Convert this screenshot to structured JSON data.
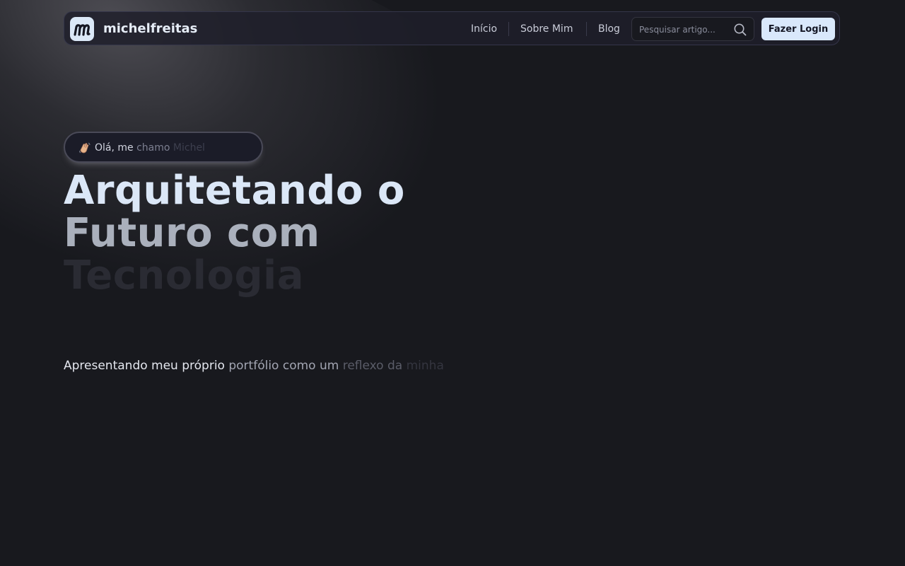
{
  "nav": {
    "brand": "michelfreitas",
    "logo_letter": "m",
    "links": [
      "Início",
      "Sobre Mim",
      "Blog"
    ],
    "search_placeholder": "Pesquisar artigo...",
    "login_label": "Fazer Login",
    "search_icon": "search-icon"
  },
  "hero": {
    "greeting_icon": "waving-hand-icon",
    "greeting": {
      "part1": "Olá, me",
      "part2": "chamo",
      "part3": "Michel"
    },
    "headline": {
      "line1": "Arquitetando o",
      "line2": "Futuro com",
      "line3": "Tecnologia"
    },
    "subtitle": {
      "part1": "Apresentando meu próprio",
      "part2": "portfólio como um",
      "part3": "reflexo da",
      "part4": "minha"
    }
  },
  "colors": {
    "background": "#18191e",
    "accent": "#d9e8fb",
    "nav_border": "#34354a"
  }
}
